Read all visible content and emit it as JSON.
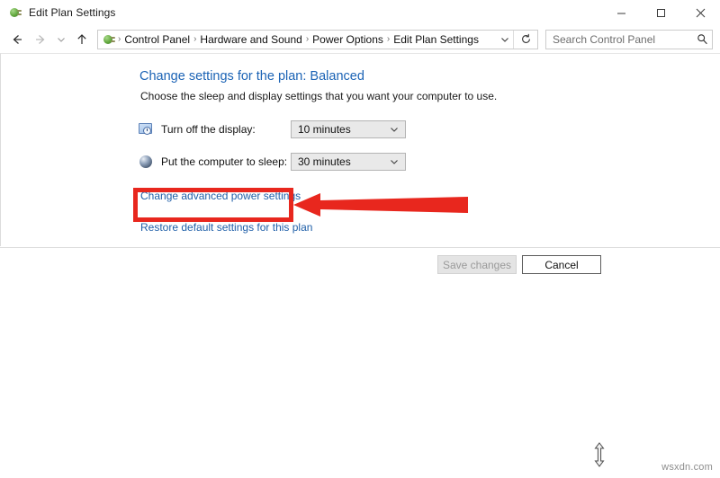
{
  "window": {
    "title": "Edit Plan Settings",
    "app_icon": "power-plug-icon",
    "controls": {
      "minimize_label": "Minimize",
      "maximize_label": "Maximize",
      "close_label": "Close"
    }
  },
  "navbar": {
    "back_label": "Back",
    "forward_label": "Forward",
    "recent_label": "Recent locations",
    "up_label": "Up one level",
    "refresh_label": "Refresh",
    "breadcrumbs": [
      "Control Panel",
      "Hardware and Sound",
      "Power Options",
      "Edit Plan Settings"
    ],
    "separator": "›",
    "search": {
      "placeholder": "Search Control Panel",
      "value": ""
    }
  },
  "content": {
    "heading": "Change settings for the plan: Balanced",
    "subheading": "Choose the sleep and display settings that you want your computer to use.",
    "settings": [
      {
        "icon": "display-clock-icon",
        "label": "Turn off the display:",
        "value": "10 minutes"
      },
      {
        "icon": "moon-sleep-icon",
        "label": "Put the computer to sleep:",
        "value": "30 minutes"
      }
    ],
    "links": [
      "Change advanced power settings",
      "Restore default settings for this plan"
    ]
  },
  "buttons": {
    "save": "Save changes",
    "cancel": "Cancel"
  },
  "annotations": {
    "highlight_color": "#e8271e",
    "arrow_color": "#e8271e",
    "target": "Change advanced power settings"
  },
  "cursor": {
    "type": "vertical-resize-cursor"
  },
  "watermark": "wsxdn.com"
}
